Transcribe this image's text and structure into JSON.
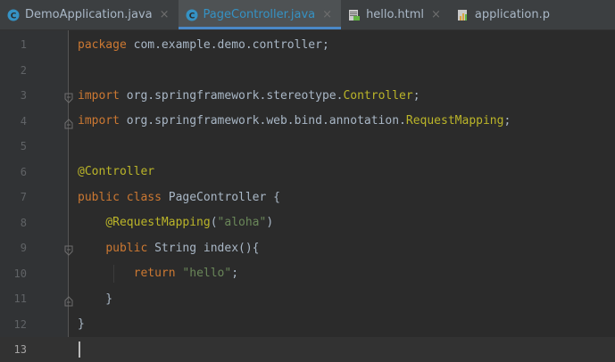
{
  "tabs": [
    {
      "label": "DemoApplication.java",
      "icon": "java-class-icon",
      "active": false
    },
    {
      "label": "PageController.java",
      "icon": "java-class-icon",
      "active": true
    },
    {
      "label": "hello.html",
      "icon": "html-file-icon",
      "active": false
    },
    {
      "label": "application.p",
      "icon": "properties-file-icon",
      "active": false
    }
  ],
  "close_glyph": "×",
  "lines": [
    {
      "n": "1",
      "tokens": [
        [
          "kw",
          "package "
        ],
        [
          "",
          "com.example.demo.controller;"
        ]
      ]
    },
    {
      "n": "2",
      "tokens": []
    },
    {
      "n": "3",
      "tokens": [
        [
          "kw",
          "import "
        ],
        [
          "",
          "org.springframework.stereotype."
        ],
        [
          "ann",
          "Controller"
        ],
        [
          "",
          ";"
        ]
      ]
    },
    {
      "n": "4",
      "tokens": [
        [
          "kw",
          "import "
        ],
        [
          "",
          "org.springframework.web.bind.annotation."
        ],
        [
          "ann",
          "RequestMapping"
        ],
        [
          "",
          ";"
        ]
      ]
    },
    {
      "n": "5",
      "tokens": []
    },
    {
      "n": "6",
      "tokens": [
        [
          "ann",
          "@Controller"
        ]
      ]
    },
    {
      "n": "7",
      "tokens": [
        [
          "kw",
          "public class "
        ],
        [
          "",
          "PageController {"
        ]
      ]
    },
    {
      "n": "8",
      "tokens": [
        [
          "",
          "    "
        ],
        [
          "ann",
          "@RequestMapping"
        ],
        [
          "",
          "("
        ],
        [
          "str",
          "\"aloha\""
        ],
        [
          "",
          ")"
        ]
      ]
    },
    {
      "n": "9",
      "tokens": [
        [
          "",
          "    "
        ],
        [
          "kw",
          "public "
        ],
        [
          "",
          "String index(){"
        ]
      ]
    },
    {
      "n": "10",
      "tokens": [
        [
          "",
          "        "
        ],
        [
          "kw",
          "return "
        ],
        [
          "str",
          "\"hello\""
        ],
        [
          "",
          ";"
        ]
      ]
    },
    {
      "n": "11",
      "tokens": [
        [
          "",
          "    }"
        ]
      ]
    },
    {
      "n": "12",
      "tokens": [
        [
          "",
          "}"
        ]
      ]
    },
    {
      "n": "13",
      "tokens": []
    }
  ],
  "current_line": "13",
  "colors": {
    "keyword": "#cc7832",
    "annotation": "#bbb529",
    "string": "#6a8759",
    "text": "#a9b7c6",
    "active_tab_text": "#3592c4"
  }
}
